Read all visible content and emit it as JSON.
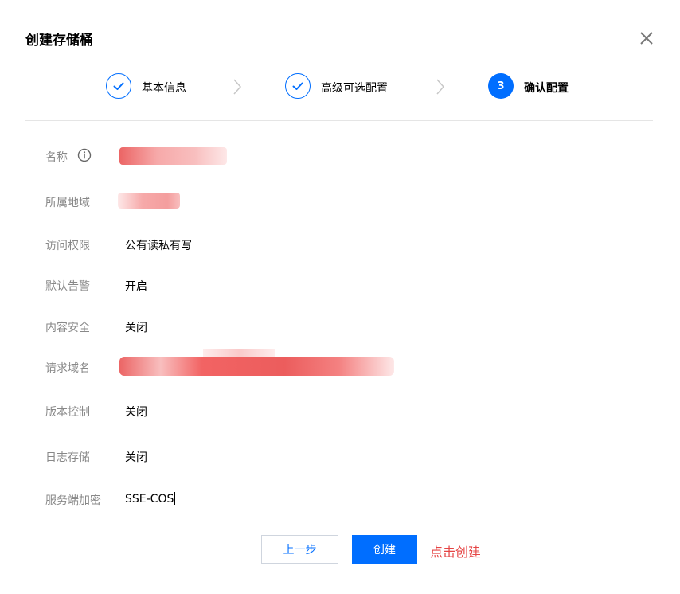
{
  "dialog": {
    "title": "创建存储桶"
  },
  "steps": [
    {
      "label": "基本信息",
      "state": "done"
    },
    {
      "label": "高级可选配置",
      "state": "done"
    },
    {
      "label": "确认配置",
      "state": "active",
      "number": "3"
    }
  ],
  "fields": {
    "name": {
      "label": "名称"
    },
    "region": {
      "label": "所属地域"
    },
    "access": {
      "label": "访问权限",
      "value": "公有读私有写"
    },
    "alarm": {
      "label": "默认告警",
      "value": "开启"
    },
    "content_security": {
      "label": "内容安全",
      "value": "关闭"
    },
    "domain": {
      "label": "请求域名"
    },
    "versioning": {
      "label": "版本控制",
      "value": "关闭"
    },
    "logging": {
      "label": "日志存储",
      "value": "关闭"
    },
    "encryption": {
      "label": "服务端加密",
      "value": "SSE-COS"
    }
  },
  "buttons": {
    "prev": "上一步",
    "create": "创建"
  },
  "annotation": "点击创建",
  "colors": {
    "accent": "#006eff",
    "annotation": "#e54545",
    "redaction": "#f04848"
  }
}
